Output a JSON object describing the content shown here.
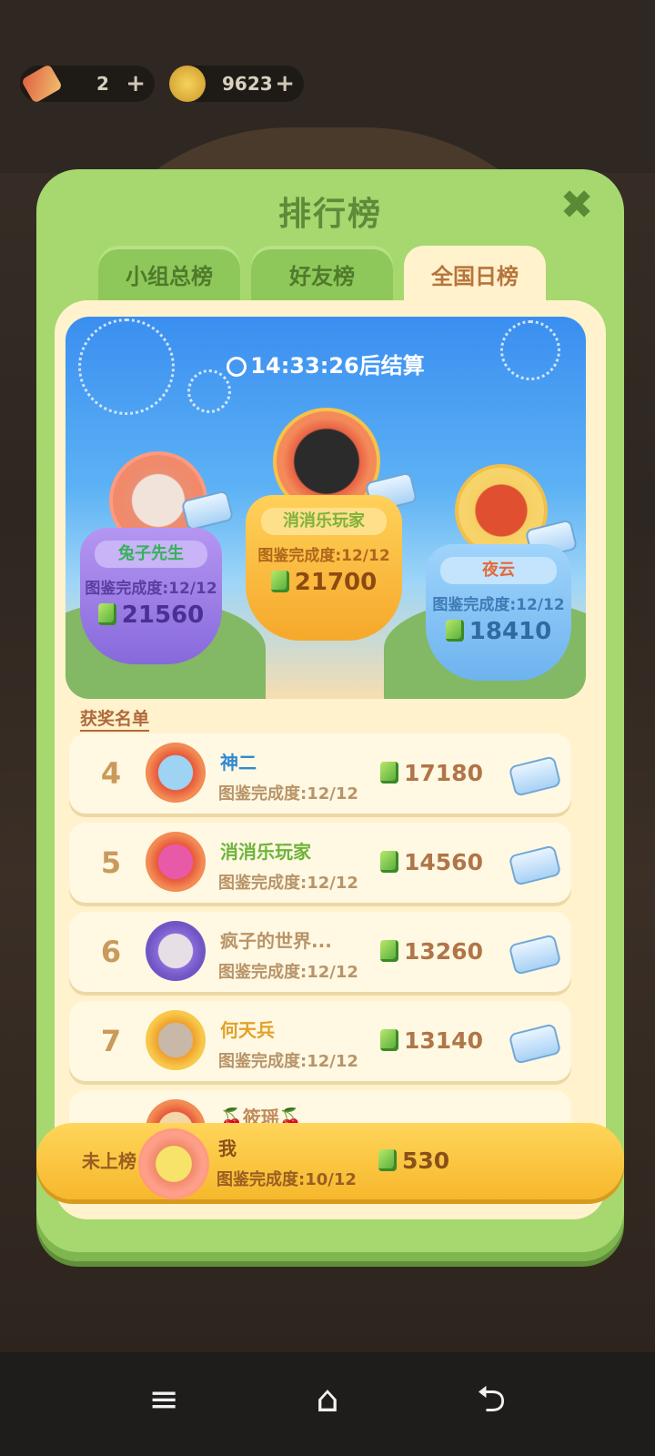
{
  "topbar": {
    "item_count": "2",
    "coin_count": "9623",
    "plus": "+"
  },
  "panel": {
    "title": "排行榜",
    "close": "✖",
    "tabs": [
      "小组总榜",
      "好友榜",
      "全国日榜"
    ],
    "active_tab": "全国日榜"
  },
  "banner": {
    "timer": "14:33:26后结算",
    "podium": [
      {
        "rank": 2,
        "name": "兔子先生",
        "progress": "图鉴完成度:12/12",
        "score": "21560"
      },
      {
        "rank": 1,
        "name": "消消乐玩家",
        "progress": "图鉴完成度:12/12",
        "score": "21700"
      },
      {
        "rank": 3,
        "name": "夜云",
        "progress": "图鉴完成度:12/12",
        "score": "18410"
      }
    ]
  },
  "list": {
    "section_label": "获奖名单",
    "rows": [
      {
        "rank": "4",
        "name": "神二",
        "progress": "图鉴完成度:12/12",
        "score": "17180"
      },
      {
        "rank": "5",
        "name": "消消乐玩家",
        "progress": "图鉴完成度:12/12",
        "score": "14560"
      },
      {
        "rank": "6",
        "name": "疯子的世界...",
        "progress": "图鉴完成度:12/12",
        "score": "13260"
      },
      {
        "rank": "7",
        "name": "何天兵",
        "progress": "图鉴完成度:12/12",
        "score": "13140"
      },
      {
        "rank": "",
        "name": "🍒筱瑶🍒",
        "progress": "",
        "score": ""
      }
    ]
  },
  "me": {
    "status": "未上榜",
    "name": "我",
    "progress": "图鉴完成度:10/12",
    "score": "530"
  },
  "navbar": {
    "menu": "≡",
    "home": "⌂",
    "back": "⮌"
  },
  "colors": {
    "panel_green": "#a6d86f",
    "inner_cream": "#fff2cc",
    "gold": "#f6b82c",
    "brown_text": "#b07548"
  }
}
